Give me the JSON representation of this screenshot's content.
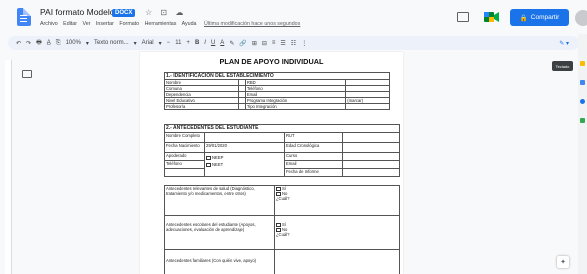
{
  "app": {
    "doc_title": "PAI formato Modelo",
    "badge": "DOCX",
    "title_icons": "☆ ⊡ ☁"
  },
  "menu": {
    "items": [
      "Archivo",
      "Editar",
      "Ver",
      "Insertar",
      "Formato",
      "Herramientas",
      "Ayuda"
    ],
    "last_edit": "Última modificación hace unos segundos"
  },
  "share": {
    "label": "Compartir"
  },
  "toolbar": {
    "items": [
      "↶",
      "↷",
      "🖶",
      "A̲",
      "⎘",
      "100%",
      "▾",
      "Texto norm...",
      "▾",
      "Arial",
      "▾",
      "−",
      "11",
      "+",
      "B",
      "I",
      "U",
      "A",
      "✎",
      "🔗",
      "⊞",
      "⊟",
      "≡",
      "☰",
      "☷",
      "⋮"
    ],
    "edit_mode": "✎ ▾"
  },
  "tooltip": {
    "text": "Teclado"
  },
  "document": {
    "title": "PLAN DE APOYO INDIVIDUAL",
    "section1": {
      "heading": "1.- IDENTIFICACIÓN DEL ESTABLECIMIENTO",
      "rows": [
        [
          "Nombre",
          "",
          "RBD",
          ""
        ],
        [
          "Comuna",
          "",
          "Teléfono",
          ""
        ],
        [
          "Dependencia",
          "",
          "Email",
          ""
        ],
        [
          "Nivel Educativo",
          "",
          "Programa Integración",
          "    (marcar)"
        ],
        [
          "Profesor/a",
          "",
          "Tipo Integración",
          ""
        ]
      ]
    },
    "section2": {
      "heading": "2.- ANTECEDENTES DEL ESTUDIANTE",
      "rows": [
        [
          "Nombre Completo",
          "",
          "RUT",
          ""
        ],
        [
          "Fecha Nacimiento",
          "29/01/2020",
          "Edad Cronológica",
          ""
        ],
        [
          "Apoderado",
          "",
          "Curso",
          ""
        ],
        [
          "Teléfono",
          "",
          "Email",
          ""
        ],
        [
          "",
          "",
          "Fecha de Informe",
          ""
        ]
      ],
      "options": [
        "NEEP",
        "NEET"
      ]
    },
    "section3": {
      "rows": [
        {
          "label": "Antecedentes relevantes de salud (Diagnóstico, tratamiento y/o medicamentos, entre otros)",
          "options": [
            "Sí",
            "No",
            "¿Cuál?"
          ]
        },
        {
          "label": "Antecedentes escolares del estudiante (Apoyos, adecuaciones, evaluación de aprendizaje)",
          "options": [
            "Sí",
            "No",
            "¿Cuál?"
          ]
        },
        {
          "label": "Antecedentes familiares (Con quién vive, apoyo)",
          "options": []
        }
      ]
    }
  },
  "colors": {
    "accent": "#1a73e8",
    "doc_icon": "#4285f4",
    "toolbar_bg": "#edf2fa"
  }
}
